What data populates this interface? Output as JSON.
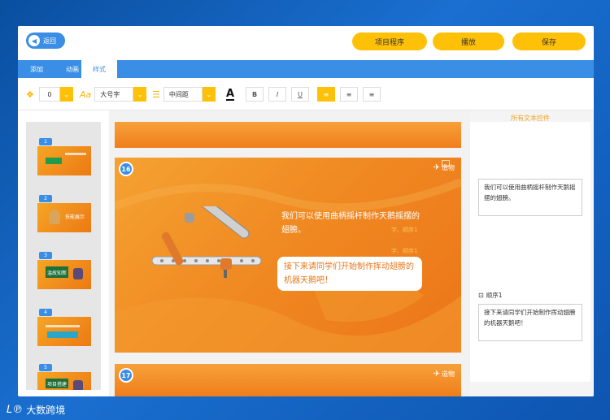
{
  "header": {
    "back_label": "返回",
    "project_label": "项目程序",
    "play_label": "播放",
    "save_label": "保存"
  },
  "tabs": [
    {
      "label": "添加",
      "active": false
    },
    {
      "label": "动画",
      "active": false
    },
    {
      "label": "样式",
      "active": true
    }
  ],
  "toolbar": {
    "layer_value": "0",
    "font_size_value": "大号字",
    "spacing_value": "中间距",
    "font_color_glyph": "A",
    "bold_label": "B",
    "italic_label": "I",
    "underline_label": "U"
  },
  "thumbnails": [
    {
      "num": "1"
    },
    {
      "num": "2"
    },
    {
      "num": "3"
    },
    {
      "num": "4"
    },
    {
      "num": "5"
    }
  ],
  "thumb_texts": {
    "t2": "技能展示",
    "t3": "温故知新",
    "t5": "项目搭建"
  },
  "slides": {
    "main_num": "16",
    "next_num": "17",
    "logo_text": "造物",
    "text1": "我们可以使用曲柄摇杆制作天鹅摇摆的翅膀。",
    "ghost1": "字、顺序1",
    "ghost2": "字、顺序1",
    "bubble_text": "接下来请同学们开始制作挥动翅膀的机器天鹅吧！"
  },
  "right_panel": {
    "title": "所有文本控件",
    "text_box_1": "我们可以使用曲柄摇杆制作天鹅摇摆的翅膀。",
    "order_label": "顺序1",
    "text_box_2": "接下来请同学们开始制作挥动翅膀的机器天鹅吧！"
  },
  "watermark": "大数跨境",
  "colors": {
    "primary_blue": "#3a8ee6",
    "accent_yellow": "#ffc107",
    "slide_orange": "#f08a22"
  }
}
